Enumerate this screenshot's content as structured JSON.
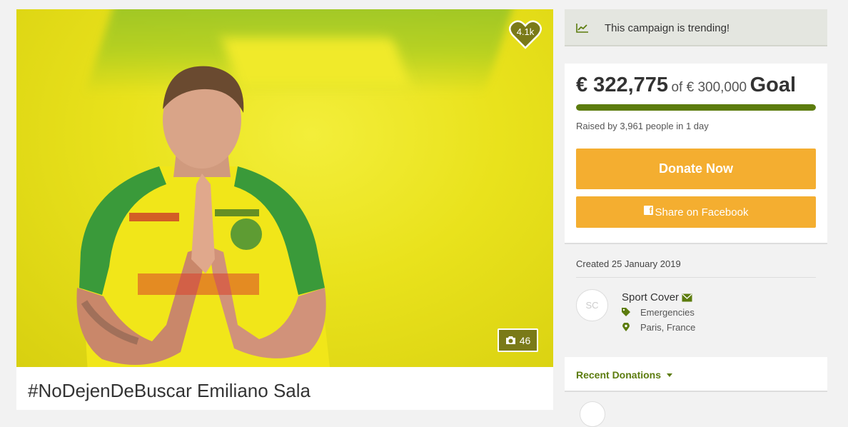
{
  "campaign": {
    "title": "#NoDejenDeBuscar Emiliano Sala",
    "likes": "4.1k",
    "photo_count": "46"
  },
  "trending": {
    "text": "This campaign is trending!",
    "icon": "chart-line-icon"
  },
  "funding": {
    "raised": "€ 322,775",
    "of_goal": "of € 300,000",
    "goal_word": "Goal",
    "progress_fraction": 1.0,
    "raised_by": "Raised by 3,961 people in 1 day",
    "donate_label": "Donate Now",
    "share_label": "Share on Facebook"
  },
  "details": {
    "created": "Created 25 January 2019",
    "organizer_initials": "SC",
    "organizer_name": "Sport Cover",
    "category": "Emergencies",
    "location": "Paris, France"
  },
  "recent": {
    "label": "Recent Donations"
  },
  "colors": {
    "accent_green": "#5c7c0e",
    "button_orange": "#f4ae30",
    "badge_olive": "#7a7a18"
  }
}
